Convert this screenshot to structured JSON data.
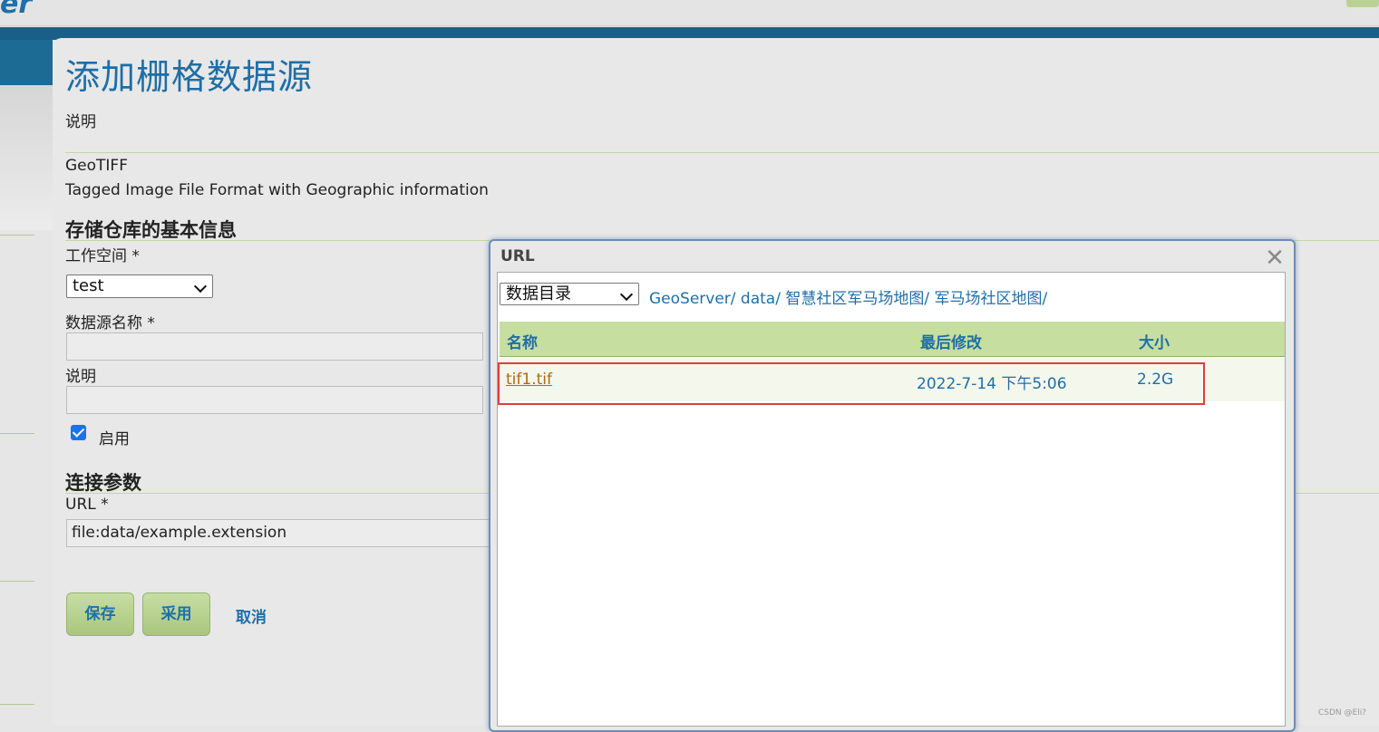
{
  "header": {},
  "page": {
    "title": "添加栅格数据源",
    "description_label": "说明",
    "format_name": "GeoTIFF",
    "format_description": "Tagged Image File Format with Geographic information"
  },
  "basic_info": {
    "section_title": "存储仓库的基本信息",
    "workspace_label": "工作空间 *",
    "workspace_value": "test",
    "datasource_name_label": "数据源名称 *",
    "datasource_name_value": "",
    "description_label": "说明",
    "description_value": "",
    "enabled_label": "启用",
    "enabled": true
  },
  "connection": {
    "section_title": "连接参数",
    "url_label": "URL *",
    "url_value": "file:data/example.extension"
  },
  "buttons": {
    "save": "保存",
    "apply": "采用",
    "cancel": "取消"
  },
  "dialog": {
    "title": "URL",
    "close_glyph": "✕",
    "directory_select": "数据目录",
    "breadcrumb": "GeoServer/ data/ 智慧社区军马场地图/ 军马场社区地图/",
    "columns": {
      "name": "名称",
      "modified": "最后修改",
      "size": "大小"
    },
    "files": [
      {
        "name": "tif1.tif",
        "modified": "2022-7-14 下午5:06",
        "size": "2.2G"
      }
    ]
  },
  "watermark": "CSDN @Eli?",
  "colors": {
    "title_blue": "#1e6ea6",
    "header_band": "#1a5f86",
    "button_green": "#b9d293",
    "highlight_red": "#e23c3c"
  }
}
